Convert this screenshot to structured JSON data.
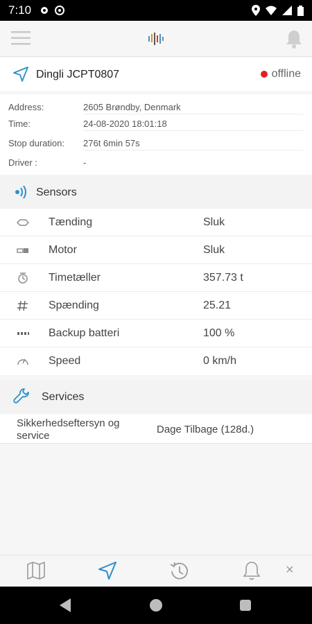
{
  "status_bar": {
    "time": "7:10",
    "icons": [
      "gear-icon",
      "at-icon",
      "location-icon",
      "wifi-icon",
      "signal-icon",
      "battery-icon"
    ]
  },
  "app_bar": {
    "menu_icon": "hamburger-icon",
    "logo_icon": "logo-bars-icon",
    "bell_icon": "bell-icon"
  },
  "device": {
    "name": "Dingli JCPT0807",
    "status": "offline",
    "status_color": "#e0202a"
  },
  "info": {
    "rows": [
      {
        "key": "Address:",
        "value": "2605 Brøndby, Denmark"
      },
      {
        "key": "Time:",
        "value": "24-08-2020 18:01:18"
      },
      {
        "key": "Stop duration:",
        "value": "276t 6min 57s"
      },
      {
        "key": "Driver :",
        "value": "-"
      }
    ]
  },
  "sensors": {
    "title": "Sensors",
    "rows": [
      {
        "icon": "ignition-icon",
        "label": "Tænding",
        "value": "Sluk"
      },
      {
        "icon": "engine-icon",
        "label": "Motor",
        "value": "Sluk"
      },
      {
        "icon": "hour-counter-icon",
        "label": "Timetæller",
        "value": "357.73 t"
      },
      {
        "icon": "hash-icon",
        "label": "Spænding",
        "value": "25.21"
      },
      {
        "icon": "battery-dots-icon",
        "label": "Backup batteri",
        "value": "100 %"
      },
      {
        "icon": "speedometer-icon",
        "label": "Speed",
        "value": "0 km/h"
      }
    ]
  },
  "services": {
    "title": "Services",
    "rows": [
      {
        "label": "Sikkerhedseftersyn og service",
        "value": "Dage Tilbage (128d.)"
      }
    ]
  },
  "bottom_tabs": {
    "items": [
      "map-icon",
      "navigation-icon",
      "history-icon",
      "bell-icon"
    ],
    "active_color": "#2a8fc9",
    "close_label": "×"
  },
  "colors": {
    "accent": "#2a8fc9"
  }
}
